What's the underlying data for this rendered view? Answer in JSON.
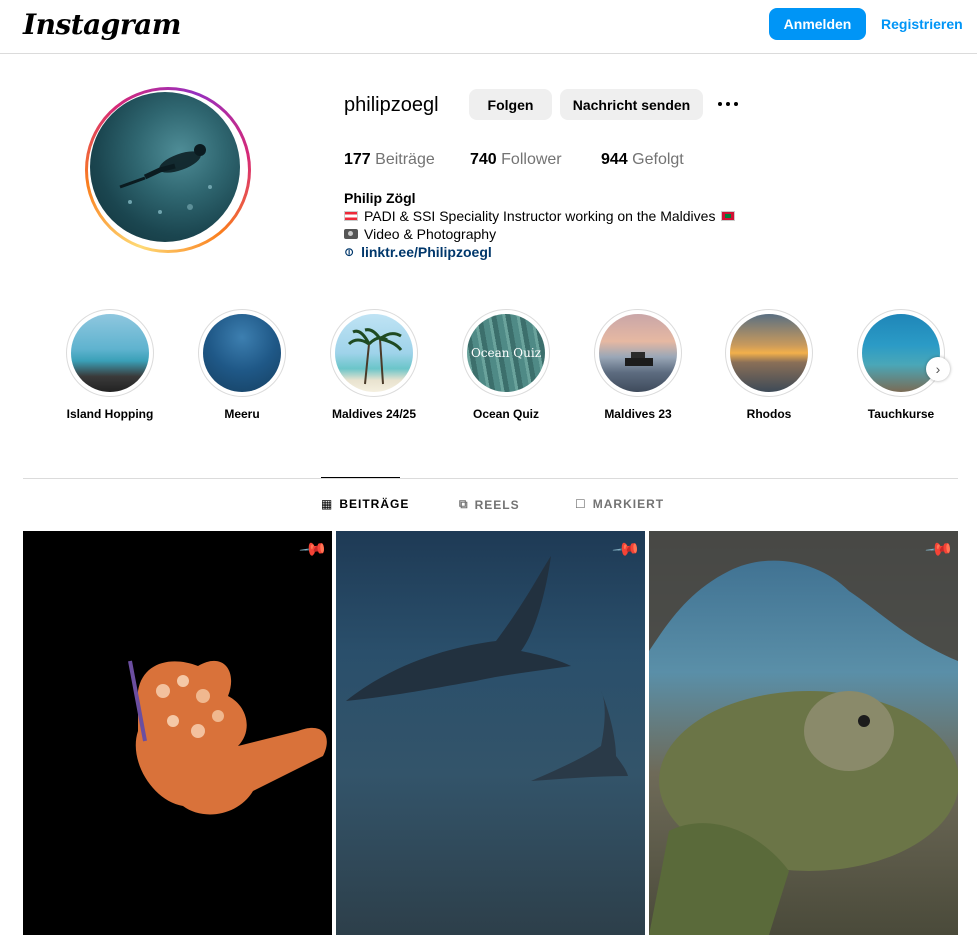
{
  "header": {
    "logo": "Instagram",
    "login_label": "Anmelden",
    "register_label": "Registrieren"
  },
  "profile": {
    "username": "philipzoegl",
    "follow_label": "Folgen",
    "message_label": "Nachricht senden",
    "stats": {
      "posts_count": "177",
      "posts_label": "Beiträge",
      "followers_count": "740",
      "followers_label": "Follower",
      "following_count": "944",
      "following_label": "Gefolgt"
    },
    "full_name": "Philip Zögl",
    "bio_line1": "PADI & SSI Speciality Instructor working on the Maldives",
    "bio_line2": "Video & Photography",
    "link": "linktr.ee/Philipzoegl"
  },
  "highlights": [
    {
      "label": "Island Hopping"
    },
    {
      "label": "Meeru"
    },
    {
      "label": "Maldives 24/25"
    },
    {
      "label": "Ocean Quiz",
      "overlay_text": "Ocean Quiz"
    },
    {
      "label": "Maldives 23"
    },
    {
      "label": "Rhodos"
    },
    {
      "label": "Tauchkurse"
    }
  ],
  "tabs": [
    {
      "label": "BEITRÄGE",
      "icon": "grid-icon",
      "active": true
    },
    {
      "label": "REELS",
      "icon": "reels-icon",
      "active": false
    },
    {
      "label": "MARKIERT",
      "icon": "tagged-icon",
      "active": false
    }
  ],
  "posts": [
    {
      "subject": "nudibranch",
      "pinned": true,
      "icon": "pin-icon"
    },
    {
      "subject": "manta-rays",
      "pinned": true,
      "icon": "pin-icon"
    },
    {
      "subject": "sea-turtle",
      "pinned": true,
      "icon": "pin-icon"
    }
  ],
  "colors": {
    "accent": "#0095f6",
    "link": "#00376b",
    "button_bg": "#efefef",
    "border": "#dbdbdb",
    "muted_text": "#737373"
  }
}
